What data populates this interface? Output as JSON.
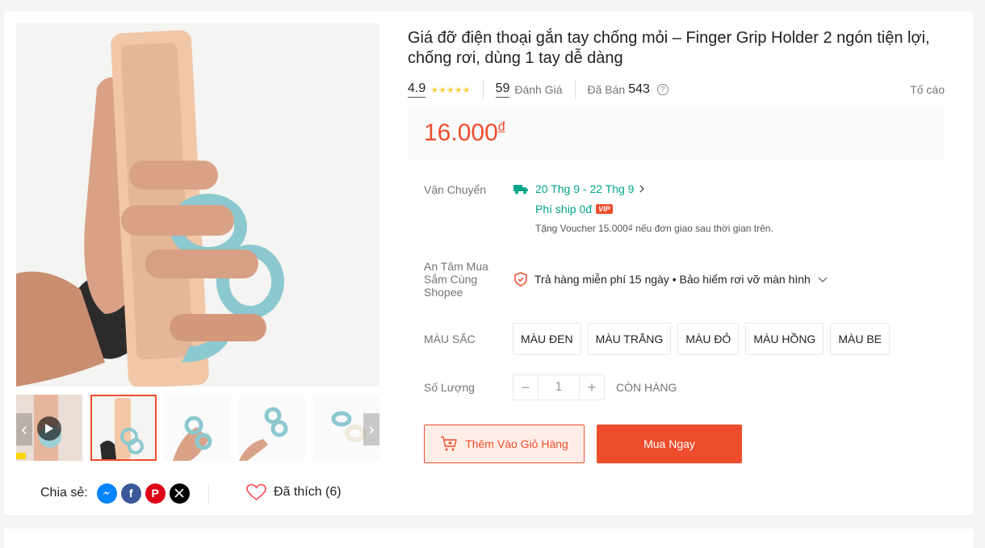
{
  "product": {
    "title": "Giá đỡ điện thoại gắn tay chống mỏi – Finger Grip Holder 2 ngón tiện lợi, chống rơi, dùng 1 tay dễ dàng",
    "rating": "4.9",
    "stars": 5,
    "reviews_count": "59",
    "reviews_label": "Đánh Giá",
    "sold_label": "Đã Bán",
    "sold_count": "543",
    "report_label": "Tố cáo",
    "price": "16.000",
    "currency": "đ"
  },
  "shipping": {
    "label": "Vận Chuyển",
    "date_range": "20 Thg 9 - 22 Thg 9",
    "fee": "Phí ship 0đ",
    "vip_badge": "VIP",
    "note": "Tặng Voucher 15.000₫ nếu đơn giao sau thời gian trên."
  },
  "assurance": {
    "label": "An Tâm Mua Sắm Cùng Shopee",
    "text": "Trả hàng miễn phí 15 ngày • Bảo hiểm rơi vỡ màn hình"
  },
  "color": {
    "label": "MÀU SẮC",
    "options": [
      "MÀU ĐEN",
      "MÀU TRẮNG",
      "MÀU ĐỎ",
      "MÀU HỒNG",
      "MÀU BE"
    ]
  },
  "quantity": {
    "label": "Số Lượng",
    "value": "1",
    "minus": "−",
    "plus": "+",
    "stock_status": "CÒN HÀNG"
  },
  "actions": {
    "add_to_cart": "Thêm Vào Giỏ Hàng",
    "buy_now": "Mua Ngay"
  },
  "share": {
    "label": "Chia sẻ:",
    "networks": [
      "messenger-icon",
      "facebook-icon",
      "pinterest-icon",
      "x-icon"
    ]
  },
  "like": {
    "label": "Đã thích (6)"
  },
  "colors": {
    "accent": "#ee4d2d",
    "shipping": "#00a58a",
    "star": "#ffce3d"
  }
}
